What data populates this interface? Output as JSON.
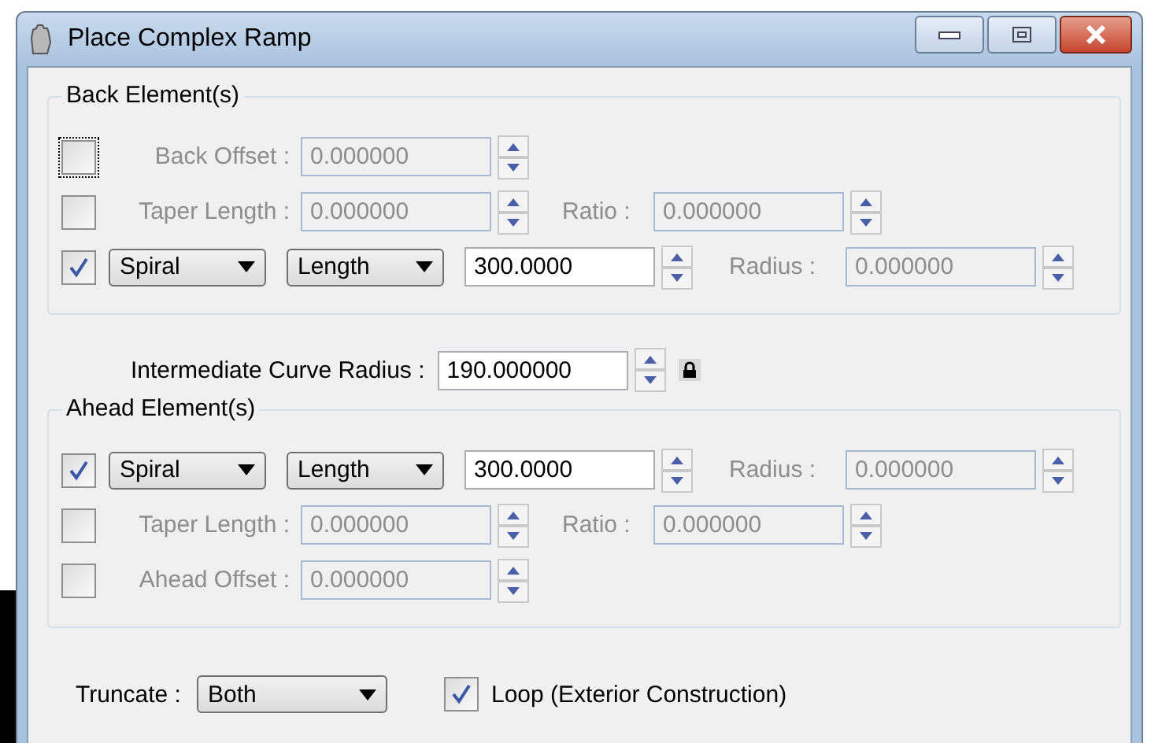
{
  "window": {
    "title": "Place Complex Ramp"
  },
  "back": {
    "title": "Back Element(s)",
    "rows": [
      {
        "kind": "offset",
        "checked": false,
        "focused": true,
        "parts": [
          {
            "kind": "label",
            "text": "Back Offset :",
            "disabled": true
          },
          {
            "kind": "field",
            "value": "0.000000",
            "disabled": true
          }
        ]
      },
      {
        "kind": "taper",
        "checked": false,
        "focused": false,
        "parts": [
          {
            "kind": "label",
            "text": "Taper Length :",
            "disabled": true
          },
          {
            "kind": "field",
            "value": "0.000000",
            "disabled": true
          },
          {
            "kind": "label",
            "text": "Ratio :",
            "disabled": true
          },
          {
            "kind": "field",
            "value": "0.000000",
            "disabled": true
          }
        ]
      },
      {
        "kind": "spiral",
        "checked": true,
        "focused": false,
        "parts": [
          {
            "kind": "dropdown",
            "value": "Spiral"
          },
          {
            "kind": "dropdown",
            "value": "Length"
          },
          {
            "kind": "field",
            "value": "300.0000",
            "disabled": false
          },
          {
            "kind": "label",
            "text": "Radius :",
            "disabled": true
          },
          {
            "kind": "field",
            "value": "0.000000",
            "disabled": true
          }
        ]
      }
    ]
  },
  "intermediate": {
    "label": "Intermediate Curve Radius :",
    "value": "190.000000",
    "locked": true
  },
  "ahead": {
    "title": "Ahead Element(s)",
    "rows": [
      {
        "kind": "spiral",
        "checked": true,
        "focused": false,
        "parts": [
          {
            "kind": "dropdown",
            "value": "Spiral"
          },
          {
            "kind": "dropdown",
            "value": "Length"
          },
          {
            "kind": "field",
            "value": "300.0000",
            "disabled": false
          },
          {
            "kind": "label",
            "text": "Radius :",
            "disabled": true
          },
          {
            "kind": "field",
            "value": "0.000000",
            "disabled": true
          }
        ]
      },
      {
        "kind": "taper",
        "checked": false,
        "focused": false,
        "parts": [
          {
            "kind": "label",
            "text": "Taper Length :",
            "disabled": true
          },
          {
            "kind": "field",
            "value": "0.000000",
            "disabled": true
          },
          {
            "kind": "label",
            "text": "Ratio :",
            "disabled": true
          },
          {
            "kind": "field",
            "value": "0.000000",
            "disabled": true
          }
        ]
      },
      {
        "kind": "offset",
        "checked": false,
        "focused": false,
        "parts": [
          {
            "kind": "label",
            "text": "Ahead Offset :",
            "disabled": true
          },
          {
            "kind": "field",
            "value": "0.000000",
            "disabled": true
          }
        ]
      }
    ]
  },
  "truncate": {
    "label": "Truncate :",
    "value": "Both"
  },
  "loop": {
    "label": "Loop (Exterior Construction)",
    "checked": true
  }
}
